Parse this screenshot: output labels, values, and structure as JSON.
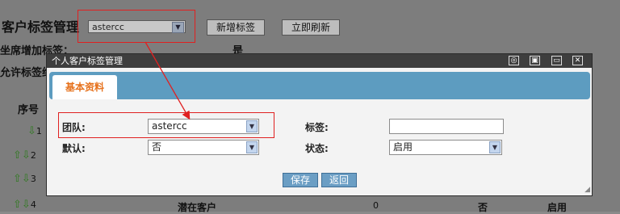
{
  "background": {
    "page_title": "客户标签管理",
    "team_select_value": "astercc",
    "add_tag_button": "新增标签",
    "refresh_button": "立即刷新",
    "row1_label": "坐席增加标签：",
    "row1_value": "是",
    "row2_label": "允许标签维",
    "seq_header": "序号",
    "row_nums": [
      "1",
      "2",
      "3",
      "4"
    ],
    "bottom_row": {
      "name": "潜在客户",
      "count": "0",
      "default": "否",
      "status": "启用"
    }
  },
  "dialog": {
    "title": "个人客户标签管理",
    "tab_label": "基本资料",
    "fields": {
      "team_label": "团队:",
      "team_value": "astercc",
      "default_label": "默认:",
      "default_value": "否",
      "tag_label": "标签:",
      "tag_value": "",
      "status_label": "状态:",
      "status_value": "启用"
    },
    "save_button": "保存",
    "back_button": "返回"
  },
  "colors": {
    "highlight": "#e02020",
    "tab_bar": "#5d9cc0",
    "tab_text": "#e6701a",
    "button": "#6b9ec4"
  }
}
